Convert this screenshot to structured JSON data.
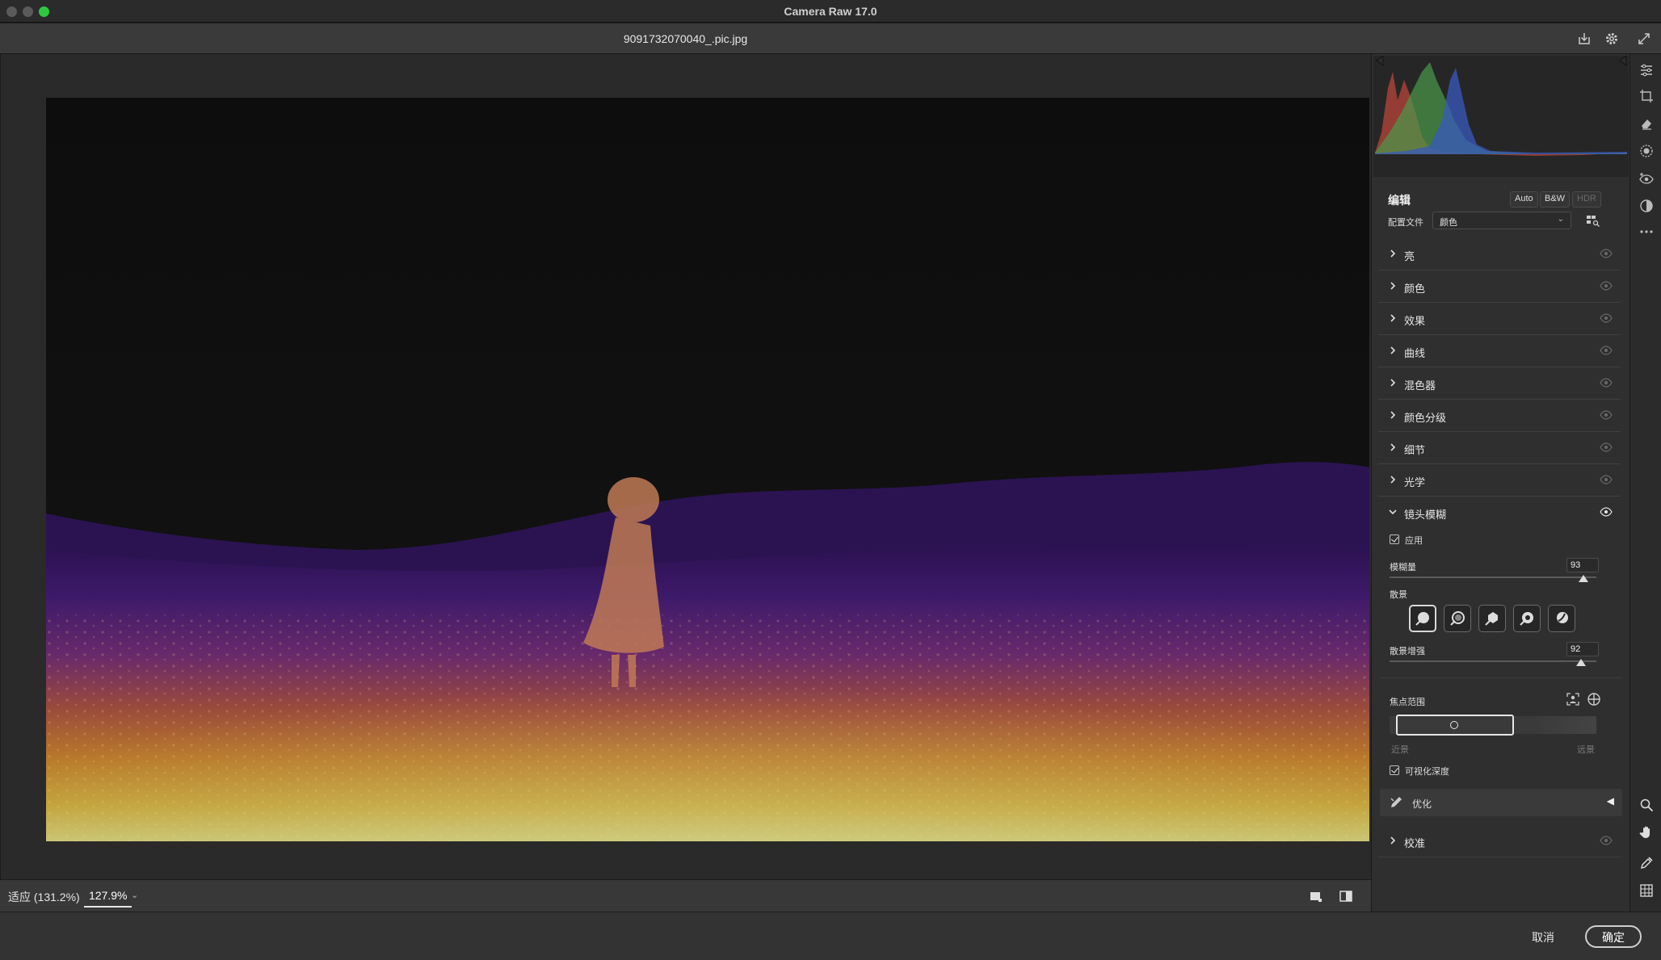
{
  "app": {
    "title": "Camera Raw 17.0",
    "filename": "9091732070040_.pic.jpg"
  },
  "zoom": {
    "fit_label": "适应 (131.2%)",
    "value": "127.9%"
  },
  "footer": {
    "cancel": "取消",
    "ok": "确定"
  },
  "panel": {
    "edit_title": "编辑",
    "auto": "Auto",
    "bw": "B&W",
    "hdr": "HDR",
    "profile_label": "配置文件",
    "profile_value": "颜色",
    "sections": [
      {
        "label": "亮"
      },
      {
        "label": "颜色"
      },
      {
        "label": "效果"
      },
      {
        "label": "曲线"
      },
      {
        "label": "混色器"
      },
      {
        "label": "颜色分级"
      },
      {
        "label": "细节"
      },
      {
        "label": "光学"
      },
      {
        "label": "镜头模糊"
      }
    ],
    "lens_blur": {
      "apply_label": "应用",
      "apply_checked": true,
      "blur_amount_label": "模糊量",
      "blur_amount": "93",
      "bokeh_label": "散景",
      "bokeh_boost_label": "散景增强",
      "bokeh_boost": "92",
      "focal_range_label": "焦点范围",
      "near_label": "近景",
      "far_label": "远景",
      "visualize_label": "可视化深度",
      "visualize_checked": true,
      "refine_label": "优化"
    },
    "calibration": "校准"
  },
  "colors": {
    "accent": "#2ec840",
    "panel_bg": "#2f2f2f"
  }
}
